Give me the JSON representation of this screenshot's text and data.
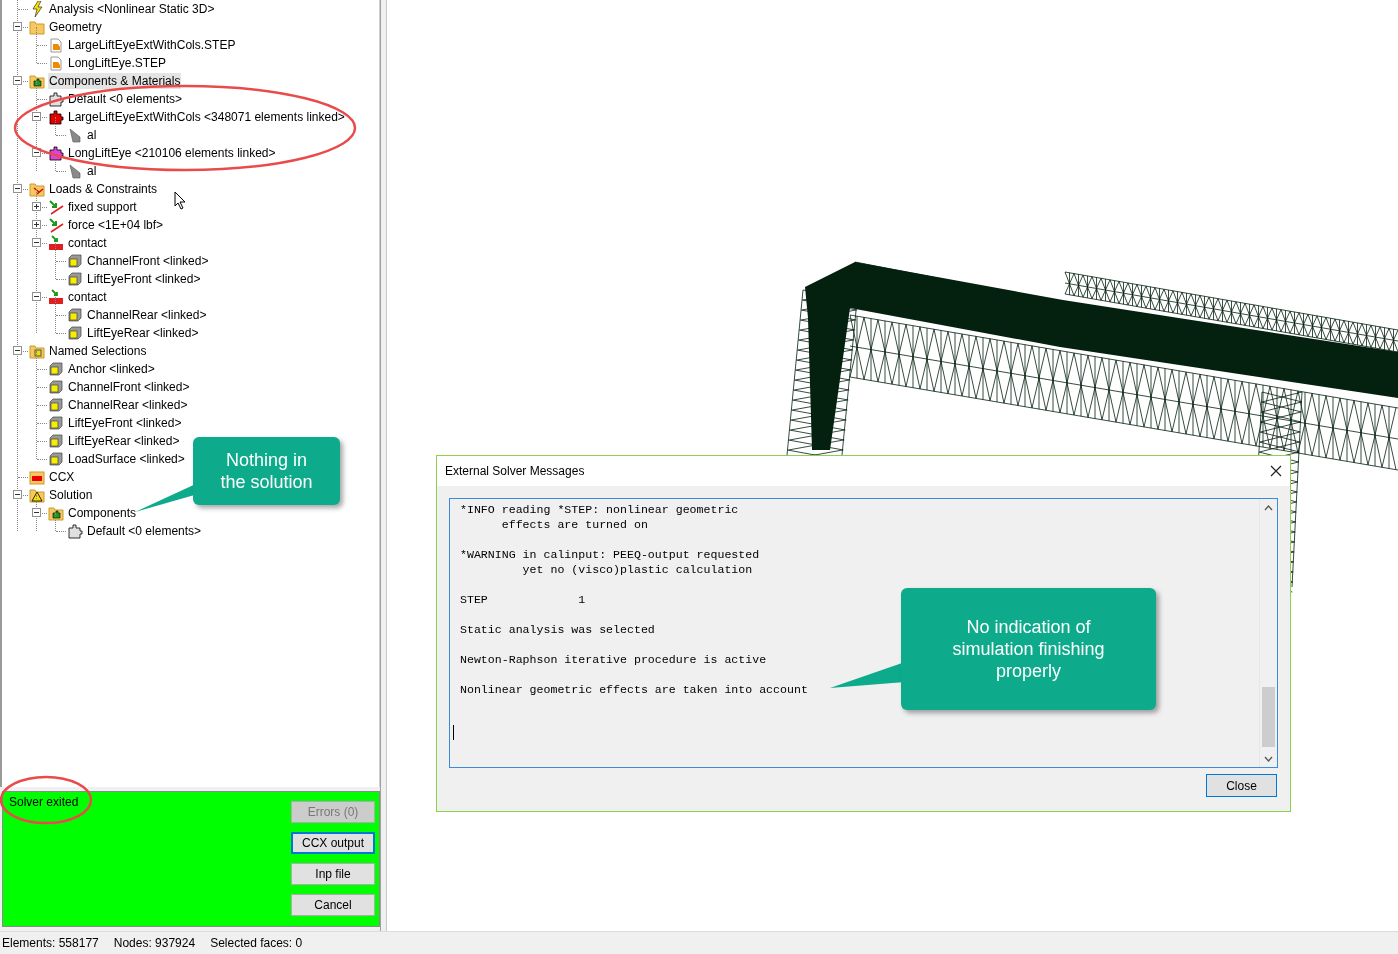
{
  "tree": [
    {
      "label": "Analysis <Nonlinear Static 3D>",
      "kind": "analysis",
      "selected": false
    },
    {
      "label": "Geometry",
      "kind": "folder",
      "expanded": true,
      "selected": false,
      "children": [
        {
          "label": "LargeLiftEyeExtWithCols.STEP",
          "kind": "step-file",
          "selected": false
        },
        {
          "label": "LongLiftEye.STEP",
          "kind": "step-file",
          "selected": false
        }
      ]
    },
    {
      "label": "Components & Materials",
      "kind": "components-folder",
      "expanded": true,
      "selected": true,
      "children": [
        {
          "label": "Default <0 elements>",
          "kind": "part",
          "color": "#e0e0e0",
          "selected": false
        },
        {
          "label": "LargeLiftEyeExtWithCols <348071 elements linked>",
          "kind": "part",
          "color": "#e00000",
          "expanded": true,
          "selected": false,
          "children": [
            {
              "label": "al",
              "kind": "material",
              "selected": false
            }
          ]
        },
        {
          "label": "LongLiftEye <210106 elements linked>",
          "kind": "part",
          "color": "#e040e0",
          "expanded": true,
          "selected": false,
          "children": [
            {
              "label": "al",
              "kind": "material",
              "selected": false
            }
          ]
        }
      ]
    },
    {
      "label": "Loads & Constraints",
      "kind": "loads-folder",
      "expanded": true,
      "selected": false,
      "children": [
        {
          "label": "fixed support",
          "kind": "load",
          "expanded": false,
          "selected": false
        },
        {
          "label": "force <1E+04 lbf>",
          "kind": "load",
          "expanded": false,
          "selected": false
        },
        {
          "label": "contact",
          "kind": "contact",
          "expanded": true,
          "selected": false,
          "children": [
            {
              "label": "ChannelFront <linked>",
              "kind": "selection",
              "selected": false
            },
            {
              "label": "LiftEyeFront <linked>",
              "kind": "selection",
              "selected": false
            }
          ]
        },
        {
          "label": "contact",
          "kind": "contact",
          "expanded": true,
          "selected": false,
          "children": [
            {
              "label": "ChannelRear <linked>",
              "kind": "selection",
              "selected": false
            },
            {
              "label": "LiftEyeRear <linked>",
              "kind": "selection",
              "selected": false
            }
          ]
        }
      ]
    },
    {
      "label": "Named Selections",
      "kind": "selections-folder",
      "expanded": true,
      "selected": false,
      "children": [
        {
          "label": "Anchor <linked>",
          "kind": "selection",
          "selected": false
        },
        {
          "label": "ChannelFront <linked>",
          "kind": "selection",
          "selected": false
        },
        {
          "label": "ChannelRear <linked>",
          "kind": "selection",
          "selected": false
        },
        {
          "label": "LiftEyeFront <linked>",
          "kind": "selection",
          "selected": false
        },
        {
          "label": "LiftEyeRear <linked>",
          "kind": "selection",
          "selected": false
        },
        {
          "label": "LoadSurface <linked>",
          "kind": "selection",
          "selected": false
        }
      ]
    },
    {
      "label": "CCX",
      "kind": "ccx-folder",
      "selected": false
    },
    {
      "label": "Solution",
      "kind": "solution-folder",
      "expanded": true,
      "selected": false,
      "children": [
        {
          "label": "Components",
          "kind": "components-folder",
          "expanded": true,
          "selected": false,
          "children": [
            {
              "label": "Default <0 elements>",
              "kind": "part",
              "color": "#e0e0e0",
              "selected": false
            }
          ]
        }
      ]
    }
  ],
  "solver_panel": {
    "status": "Solver exited",
    "buttons": [
      {
        "label": "Errors (0)",
        "disabled": true,
        "focused": false
      },
      {
        "label": "CCX output",
        "disabled": false,
        "focused": true
      },
      {
        "label": "Inp file",
        "disabled": false,
        "focused": false
      },
      {
        "label": "Cancel",
        "disabled": false,
        "focused": false
      }
    ]
  },
  "dialog": {
    "title": "External Solver Messages",
    "messages": [
      [
        "*INFO reading *STEP: nonlinear geometric",
        "      effects are turned on"
      ],
      [
        "*WARNING in calinput: PEEQ-output requested",
        "         yet no (visco)plastic calculation"
      ],
      [
        "STEP             1"
      ],
      [
        "Static analysis was selected"
      ],
      [
        "Newton-Raphson iterative procedure is active"
      ],
      [
        "Nonlinear geometric effects are taken into account"
      ]
    ],
    "button": "Close"
  },
  "callouts": [
    {
      "lines": [
        "Nothing in",
        "the solution"
      ]
    },
    {
      "lines": [
        "No indication of",
        "simulation finishing",
        "properly"
      ]
    }
  ],
  "status_bar": [
    "Elements: 558177",
    "Nodes: 937924",
    "Selected faces: 0"
  ]
}
